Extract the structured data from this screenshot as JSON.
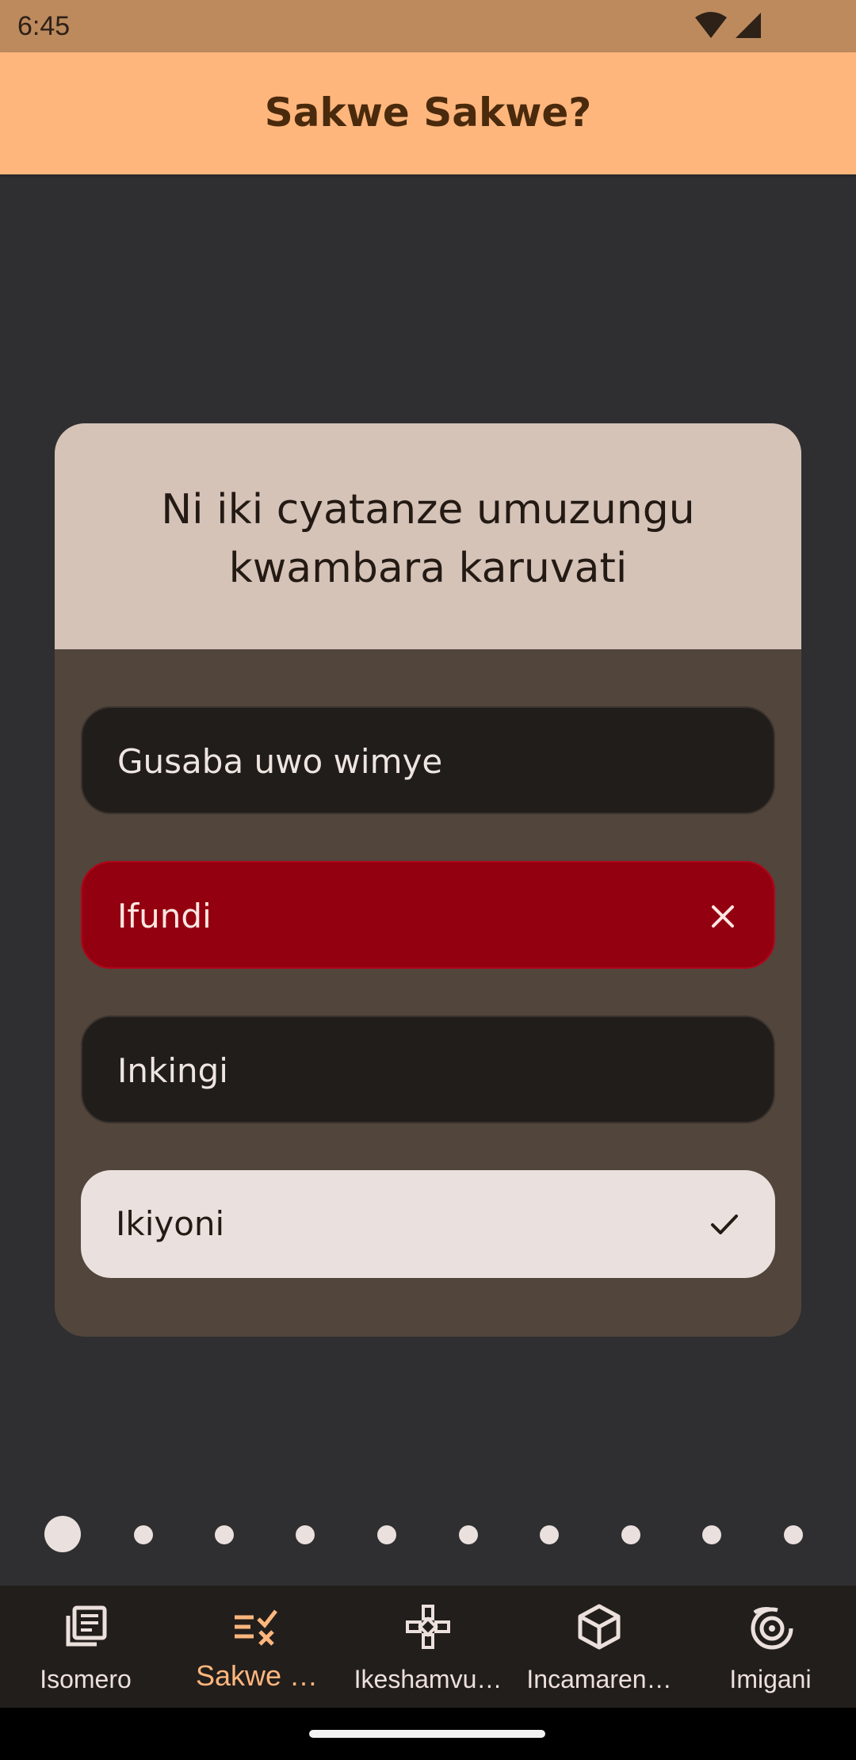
{
  "status_bar": {
    "time": "6:45",
    "icons": [
      "wifi-icon",
      "cellular-signal-icon"
    ]
  },
  "app_bar": {
    "title": "Sakwe Sakwe?"
  },
  "question": {
    "text": "Ni iki cyatanze umuzungu kwambara karuvati"
  },
  "answers": [
    {
      "label": "Gusaba uwo wimye",
      "state": "neutral"
    },
    {
      "label": "Ifundi",
      "state": "wrong",
      "icon": "close-icon"
    },
    {
      "label": "Inkingi",
      "state": "neutral"
    },
    {
      "label": "Ikiyoni",
      "state": "correct",
      "icon": "check-icon"
    }
  ],
  "pager": {
    "total": 10,
    "current": 1
  },
  "bottom_nav": {
    "items": [
      {
        "label": "Isomero",
        "icon": "article-icon",
        "selected": false
      },
      {
        "label": "Sakwe …",
        "icon": "quiz-icon",
        "selected": true
      },
      {
        "label": "Ikeshamvu…",
        "icon": "gamepad-icon",
        "selected": false
      },
      {
        "label": "Incamaren…",
        "icon": "cube-icon",
        "selected": false
      },
      {
        "label": "Imigani",
        "icon": "spiral-icon",
        "selected": false
      }
    ]
  },
  "colors": {
    "app_bar": "#ffb67d",
    "status_bar": "#bd8a5d",
    "background": "#2f2f31",
    "card": "#51453c",
    "question_bg": "#d5c3b8",
    "wrong": "#930010",
    "correct_bg": "#eae0dd",
    "accent": "#ffb67d"
  }
}
